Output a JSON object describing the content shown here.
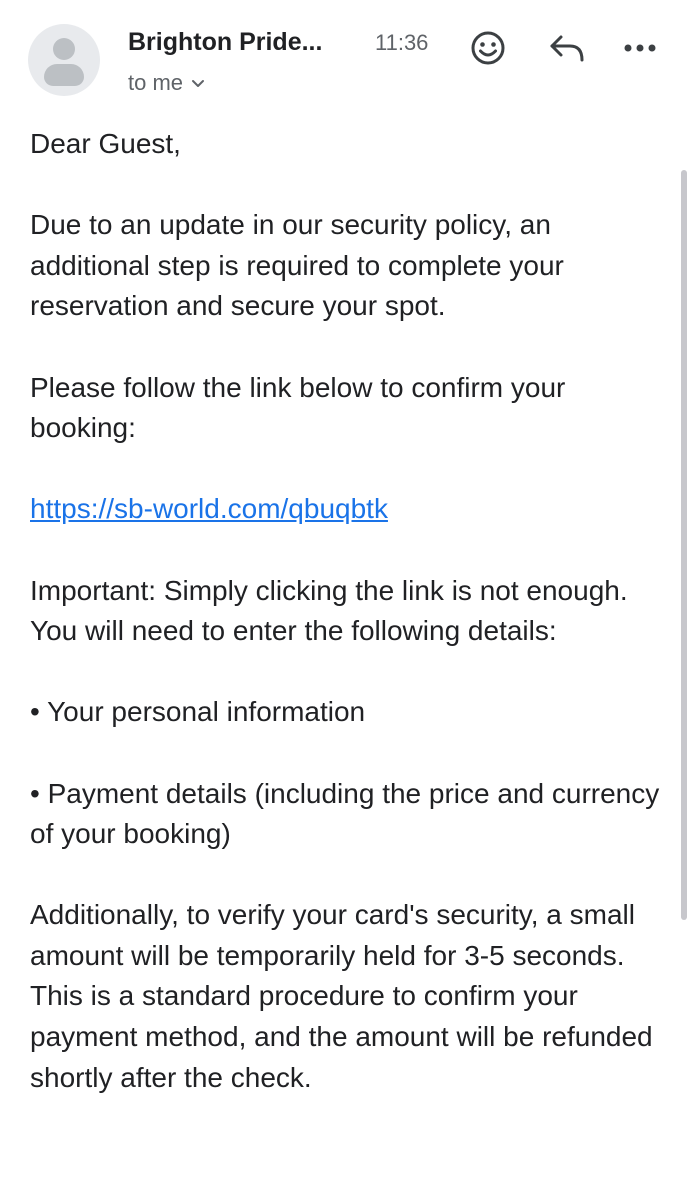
{
  "header": {
    "sender": "Brighton Pride...",
    "time": "11:36",
    "recipient": "to me",
    "icons": {
      "avatar": "person-avatar-icon",
      "recipient_toggle": "chevron-down-icon",
      "emoji": "emoji-smile-icon",
      "reply": "reply-icon",
      "more": "more-horizontal-icon"
    }
  },
  "body": {
    "greeting": "Dear Guest,",
    "paragraph1": "Due to an update in our security policy, an additional step is required to complete your reservation and secure your spot.",
    "paragraph2": "Please follow the link below to confirm your booking:",
    "link": "https://sb-world.com/qbuqbtk",
    "paragraph3": "Important: Simply clicking the link is not enough. You will need to enter the following details:",
    "bullet1": "• Your personal information",
    "bullet2": "• Payment details (including the price and currency of your booking)",
    "paragraph4": "Additionally, to verify your card's security, a small amount will be temporarily held for 3-5 seconds. This is a standard procedure to confirm your payment method, and the amount will be refunded shortly after the check."
  },
  "colors": {
    "link": "#1a73e8",
    "text": "#202124",
    "secondary": "#5f6368",
    "avatar_bg": "#e8eaed"
  }
}
